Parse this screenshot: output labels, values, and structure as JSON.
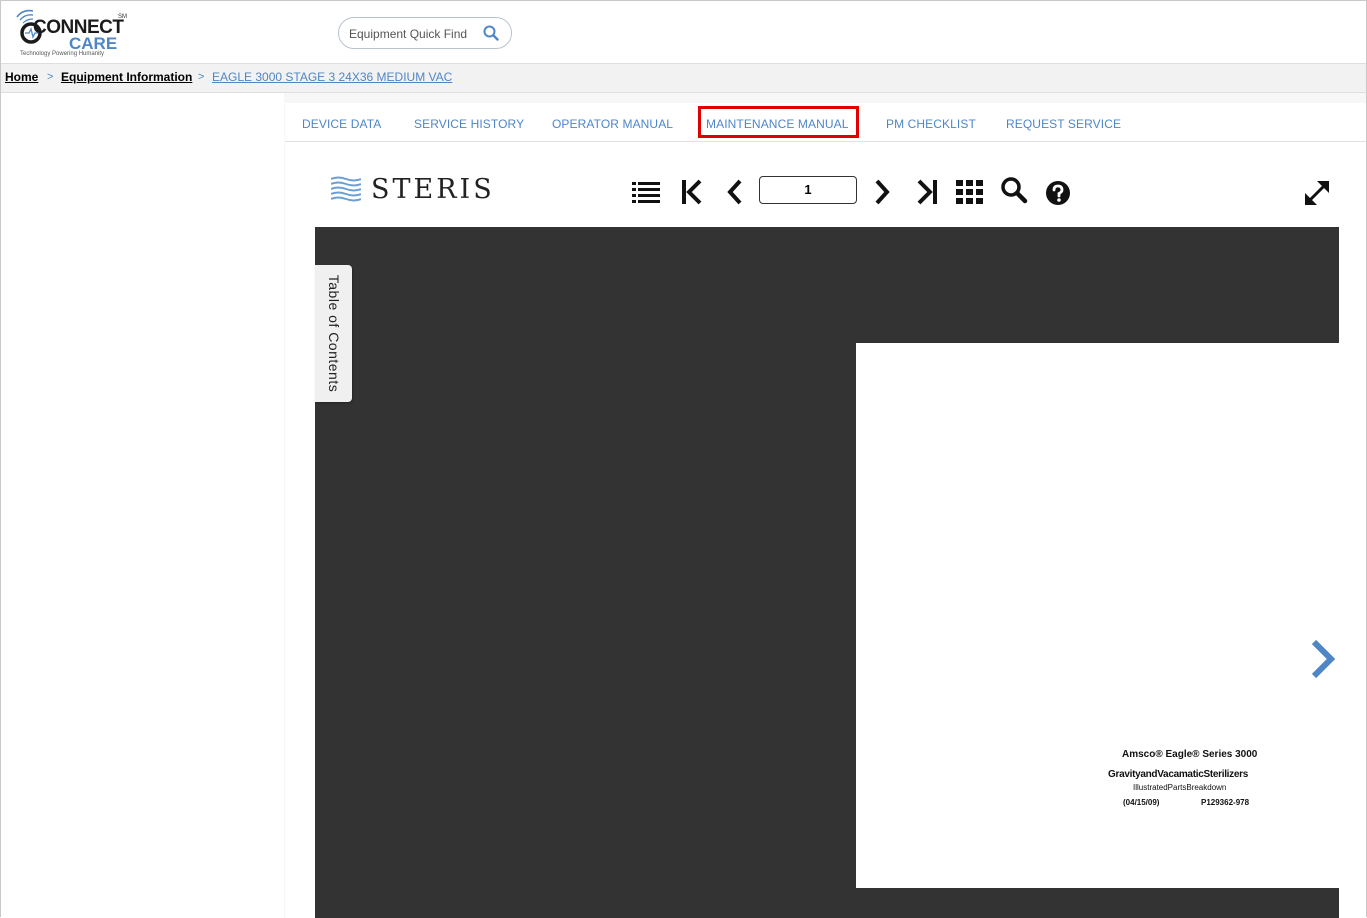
{
  "brand": {
    "name_part1": "CONNECT",
    "name_part2": "CARE",
    "trademark": "SM",
    "tagline": "Technology Powering Humanity",
    "accent_color": "#4f86c6"
  },
  "search": {
    "placeholder": "Equipment Quick Find",
    "icon": "search-icon"
  },
  "breadcrumb": {
    "items": [
      "Home",
      "Equipment Information",
      "EAGLE 3000 STAGE 3 24X36 MEDIUM VAC"
    ],
    "separator": ">"
  },
  "tabs": {
    "items": [
      {
        "label": "DEVICE DATA"
      },
      {
        "label": "SERVICE HISTORY"
      },
      {
        "label": "OPERATOR MANUAL"
      },
      {
        "label": "MAINTENANCE MANUAL"
      },
      {
        "label": "PM CHECKLIST"
      },
      {
        "label": "REQUEST SERVICE"
      }
    ],
    "active": "MAINTENANCE MANUAL",
    "highlight_color": "#e00000"
  },
  "viewer": {
    "logo_text": "STERIS",
    "current_page": "1",
    "toc_label": "Table of Contents",
    "toolbar_icons": [
      "list-icon",
      "first-page-icon",
      "previous-page-icon",
      "next-page-icon",
      "last-page-icon",
      "grid-icon",
      "search-icon",
      "help-icon",
      "fullscreen-icon"
    ],
    "stage_color": "#333333"
  },
  "document_page": {
    "line1": "Amsco® Eagle® Series 3000",
    "line2": "GravityandVacamaticSterilizers",
    "line3": "IllustratedPartsBreakdown",
    "date": "(04/15/09)",
    "part_number": "P129362-978"
  }
}
